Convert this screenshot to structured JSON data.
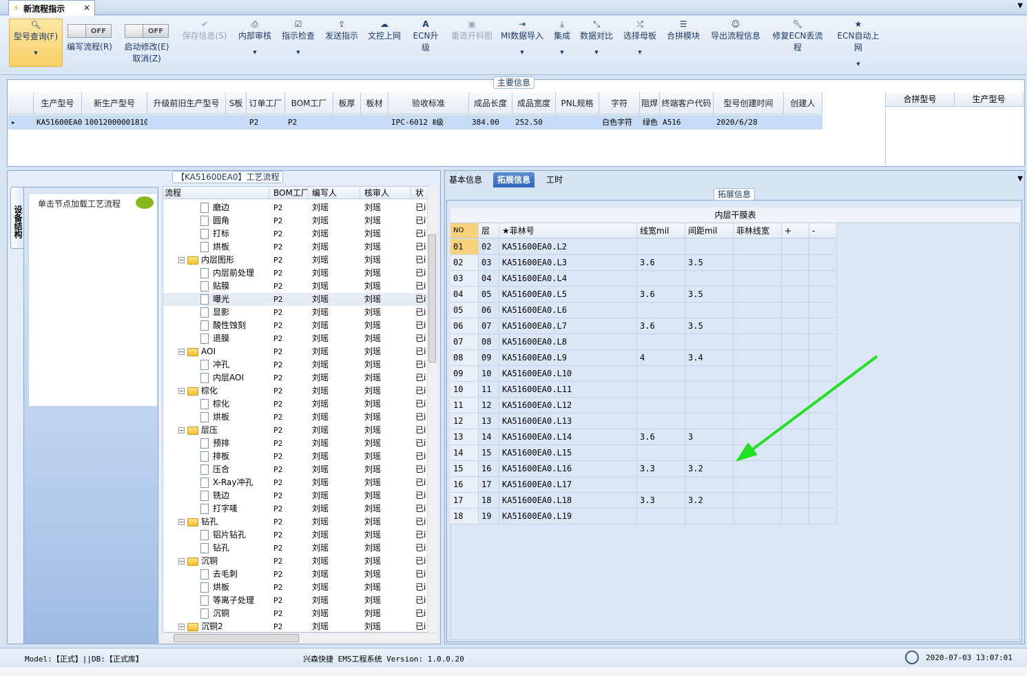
{
  "tab": {
    "title": "新流程指示",
    "close": "×"
  },
  "ribbon": {
    "query": "型号查询(F)",
    "edit": "编写流程(R)",
    "start": "启动修改(E)",
    "cancel": "取消(Z)",
    "toggle_off": "OFF",
    "buttons": [
      "保存信息(S)",
      "内部审核",
      "指示检查",
      "发送指示",
      "文控上网",
      "ECN升级",
      "重选开料图",
      "MI数据导入",
      "集成",
      "数据对比",
      "选择母板",
      "合拼模块",
      "导出流程信息",
      "修复ECN丢流程",
      "ECN自动上网"
    ]
  },
  "main": {
    "title": "主要信息",
    "headers": [
      "生产型号",
      "新生产型号",
      "升级前旧生产型号",
      "S板",
      "订单工厂",
      "BOM工厂",
      "板厚",
      "板材",
      "验收标准",
      "成品长度",
      "成品宽度",
      "PNL规格",
      "字符",
      "阻焊",
      "终端客户代码",
      "型号创建时间",
      "创建人"
    ],
    "row": [
      "KA51600EA0",
      "10012000001810",
      "",
      "",
      "P2",
      "P2",
      "",
      "",
      "IPC-6012 Ⅱ级",
      "384.00",
      "252.50",
      "",
      "白色字符",
      "绿色",
      "A516",
      "2020/6/28",
      ""
    ],
    "merge_headers": [
      "合拼型号",
      "生产型号"
    ]
  },
  "process": {
    "title": "【KA51600EA0】工艺流程",
    "side_tab": "设备结构",
    "node_hint": "单击节点加载工艺流程",
    "headers": [
      "流程",
      "BOM工厂",
      "编写人",
      "核审人",
      "状"
    ],
    "rows": [
      {
        "name": "磨边",
        "lvl": 2
      },
      {
        "name": "圆角",
        "lvl": 2
      },
      {
        "name": "打标",
        "lvl": 2
      },
      {
        "name": "烘板",
        "lvl": 2
      },
      {
        "name": "内层图形",
        "lvl": 1
      },
      {
        "name": "内层前处理",
        "lvl": 2
      },
      {
        "name": "贴膜",
        "lvl": 2
      },
      {
        "name": "曝光",
        "lvl": 2
      },
      {
        "name": "显影",
        "lvl": 2
      },
      {
        "name": "酸性蚀刻",
        "lvl": 2
      },
      {
        "name": "退膜",
        "lvl": 2
      },
      {
        "name": "AOI",
        "lvl": 1
      },
      {
        "name": "冲孔",
        "lvl": 2
      },
      {
        "name": "内层AOI",
        "lvl": 2
      },
      {
        "name": "棕化",
        "lvl": 1
      },
      {
        "name": "棕化",
        "lvl": 2
      },
      {
        "name": "烘板",
        "lvl": 2
      },
      {
        "name": "层压",
        "lvl": 1
      },
      {
        "name": "预排",
        "lvl": 2
      },
      {
        "name": "排板",
        "lvl": 2
      },
      {
        "name": "压合",
        "lvl": 2
      },
      {
        "name": "X-Ray冲孔",
        "lvl": 2
      },
      {
        "name": "铣边",
        "lvl": 2
      },
      {
        "name": "打字唛",
        "lvl": 2
      },
      {
        "name": "钻孔",
        "lvl": 1
      },
      {
        "name": "铝片钻孔",
        "lvl": 2
      },
      {
        "name": "钻孔",
        "lvl": 2
      },
      {
        "name": "沉铜",
        "lvl": 1
      },
      {
        "name": "去毛刺",
        "lvl": 2
      },
      {
        "name": "烘板",
        "lvl": 2
      },
      {
        "name": "等离子处理",
        "lvl": 2
      },
      {
        "name": "沉铜",
        "lvl": 2
      },
      {
        "name": "沉铜2",
        "lvl": 1
      },
      {
        "name": "沉铜2",
        "lvl": 2
      }
    ],
    "bom": "P2",
    "writer": "刘瑶",
    "reviewer": "刘瑶",
    "status": "已i"
  },
  "right": {
    "tabs": [
      "基本信息",
      "拓展信息",
      "工时"
    ],
    "panel_title": "拓展信息",
    "table_title": "内层干膜表",
    "headers": [
      "NO",
      "层",
      "★菲林号",
      "线宽mil",
      "间距mil",
      "菲林线宽",
      "+",
      "-"
    ],
    "rows": [
      [
        "01",
        "02",
        "KA51600EA0.L2",
        "",
        ""
      ],
      [
        "02",
        "03",
        "KA51600EA0.L3",
        "3.6",
        "3.5"
      ],
      [
        "03",
        "04",
        "KA51600EA0.L4",
        "",
        ""
      ],
      [
        "04",
        "05",
        "KA51600EA0.L5",
        "3.6",
        "3.5"
      ],
      [
        "05",
        "06",
        "KA51600EA0.L6",
        "",
        ""
      ],
      [
        "06",
        "07",
        "KA51600EA0.L7",
        "3.6",
        "3.5"
      ],
      [
        "07",
        "08",
        "KA51600EA0.L8",
        "",
        ""
      ],
      [
        "08",
        "09",
        "KA51600EA0.L9",
        "4",
        "3.4"
      ],
      [
        "09",
        "10",
        "KA51600EA0.L10",
        "",
        ""
      ],
      [
        "10",
        "11",
        "KA51600EA0.L11",
        "",
        ""
      ],
      [
        "11",
        "12",
        "KA51600EA0.L12",
        "",
        ""
      ],
      [
        "12",
        "13",
        "KA51600EA0.L13",
        "",
        ""
      ],
      [
        "13",
        "14",
        "KA51600EA0.L14",
        "3.6",
        "3"
      ],
      [
        "14",
        "15",
        "KA51600EA0.L15",
        "",
        ""
      ],
      [
        "15",
        "16",
        "KA51600EA0.L16",
        "3.3",
        "3.2"
      ],
      [
        "16",
        "17",
        "KA51600EA0.L17",
        "",
        ""
      ],
      [
        "17",
        "18",
        "KA51600EA0.L18",
        "3.3",
        "3.2"
      ],
      [
        "18",
        "19",
        "KA51600EA0.L19",
        "",
        ""
      ]
    ]
  },
  "status": {
    "model": "Model:【正式】||DB:【正式库】",
    "system": "兴森快捷 EMS工程系统 Version: 1.0.0.20",
    "datetime": "2020-07-03 13:07:01"
  },
  "colors": {
    "accent": "#2f66bb",
    "arrow": "#22e022",
    "selected_row": "#c6dcf7"
  }
}
